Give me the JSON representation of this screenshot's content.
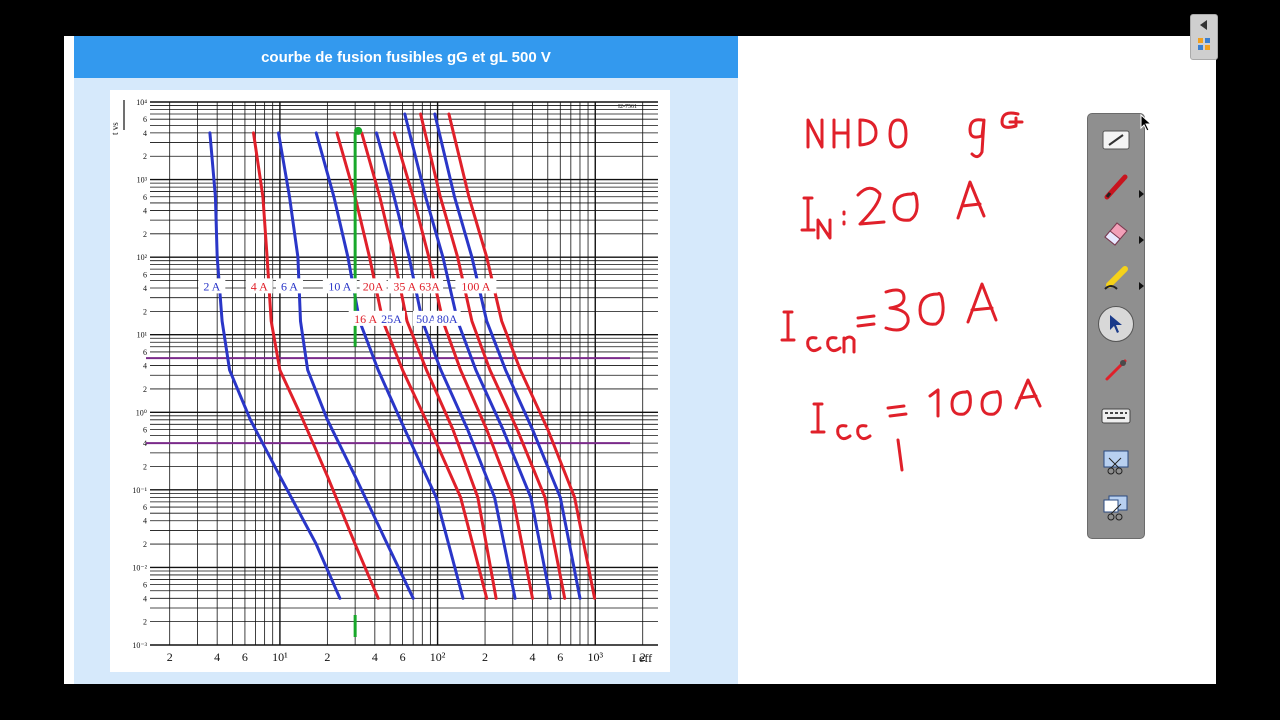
{
  "document": {
    "title": "courbe de fusion fusibles gG et gL 500 V",
    "chart_code": "I2-7561"
  },
  "chart_data": {
    "type": "line",
    "title": "courbe de fusion fusibles gG et gL 500 V",
    "xlabel": "I eff",
    "ylabel": "t vs",
    "x_scale": "log",
    "y_scale": "log",
    "xlim": [
      1.5,
      2500
    ],
    "ylim": [
      0.001,
      10000
    ],
    "x_tick_labels": [
      "2",
      "4",
      "6",
      "10¹",
      "2",
      "4",
      "6",
      "10²",
      "2",
      "4",
      "6",
      "10³",
      "2"
    ],
    "y_tick_labels": [
      "10⁴",
      "6",
      "4",
      "2",
      "10³",
      "6",
      "4",
      "2",
      "10²",
      "6",
      "4",
      "2",
      "10¹",
      "6",
      "4",
      "2",
      "10⁰",
      "6",
      "4",
      "2",
      "10⁻¹",
      "6",
      "4",
      "2",
      "10⁻²",
      "6",
      "4",
      "2",
      "10⁻³"
    ],
    "grid": true,
    "series": [
      {
        "name": "2 A",
        "color": "#2a36c8",
        "x": [
          3.6,
          3.9,
          4.0,
          4.3,
          4.8,
          6.5,
          10,
          17,
          24
        ],
        "y": [
          4000,
          600,
          100,
          15,
          3.5,
          0.8,
          0.15,
          0.02,
          0.004
        ]
      },
      {
        "name": "4 A",
        "color": "#e0202a",
        "x": [
          6.8,
          7.8,
          8.3,
          8.8,
          10,
          14,
          20,
          30,
          42
        ],
        "y": [
          4000,
          600,
          100,
          15,
          3.5,
          0.8,
          0.15,
          0.02,
          0.004
        ]
      },
      {
        "name": "6 A",
        "color": "#2a36c8",
        "x": [
          9.8,
          11.5,
          13,
          13.5,
          15,
          20,
          30,
          48,
          70
        ],
        "y": [
          4000,
          600,
          100,
          15,
          3.5,
          0.8,
          0.15,
          0.02,
          0.004
        ]
      },
      {
        "name": "10 A",
        "color": "#2a36c8",
        "x": [
          17,
          22,
          27,
          32,
          42,
          62,
          98,
          145
        ],
        "y": [
          4000,
          600,
          100,
          15,
          3.5,
          0.6,
          0.08,
          0.004
        ]
      },
      {
        "name": "16 A",
        "color": "#e0202a",
        "x": [
          23,
          30,
          37,
          45,
          60,
          90,
          140,
          205
        ],
        "y": [
          4000,
          600,
          100,
          15,
          3.5,
          0.6,
          0.08,
          0.004
        ]
      },
      {
        "name": "20A",
        "color": "#e0202a",
        "x": [
          33,
          43,
          53,
          64,
          85,
          125,
          180,
          235
        ],
        "y": [
          4000,
          600,
          100,
          15,
          3.5,
          0.6,
          0.08,
          0.004
        ]
      },
      {
        "name": "25A",
        "color": "#2a36c8",
        "x": [
          41,
          53,
          66,
          80,
          105,
          155,
          230,
          310
        ],
        "y": [
          4000,
          600,
          100,
          15,
          3.5,
          0.6,
          0.08,
          0.004
        ]
      },
      {
        "name": "35 A",
        "color": "#e0202a",
        "x": [
          53,
          70,
          88,
          108,
          140,
          205,
          300,
          400
        ],
        "y": [
          4000,
          600,
          100,
          15,
          3.5,
          0.6,
          0.08,
          0.004
        ]
      },
      {
        "name": "50A",
        "color": "#2a36c8",
        "x": [
          62,
          84,
          108,
          134,
          175,
          260,
          390,
          520
        ],
        "y": [
          7000,
          600,
          100,
          15,
          3.5,
          0.6,
          0.08,
          0.004
        ]
      },
      {
        "name": "63A",
        "color": "#e0202a",
        "x": [
          78,
          104,
          134,
          165,
          215,
          320,
          480,
          640
        ],
        "y": [
          7000,
          600,
          100,
          15,
          3.5,
          0.6,
          0.08,
          0.004
        ]
      },
      {
        "name": "80A",
        "color": "#2a36c8",
        "x": [
          96,
          128,
          165,
          205,
          270,
          400,
          600,
          800
        ],
        "y": [
          7000,
          600,
          100,
          15,
          3.5,
          0.6,
          0.08,
          0.004
        ]
      },
      {
        "name": "100 A",
        "color": "#e0202a",
        "x": [
          118,
          158,
          205,
          255,
          335,
          500,
          740,
          990
        ],
        "y": [
          7000,
          600,
          100,
          15,
          3.5,
          0.6,
          0.08,
          0.004
        ]
      }
    ],
    "series_labels": [
      {
        "name": "2 A",
        "x": 3.7,
        "y": 42
      },
      {
        "name": "4 A",
        "x": 7.4,
        "y": 42
      },
      {
        "name": "6 A",
        "x": 11.5,
        "y": 42
      },
      {
        "name": "10 A",
        "x": 24,
        "y": 42
      },
      {
        "name": "20A",
        "x": 39,
        "y": 42
      },
      {
        "name": "35 A",
        "x": 62,
        "y": 42
      },
      {
        "name": "63A",
        "x": 89,
        "y": 42
      },
      {
        "name": "100 A",
        "x": 175,
        "y": 42
      },
      {
        "name": "16 A",
        "x": 35,
        "y": 16
      },
      {
        "name": "25A",
        "x": 51,
        "y": 16
      },
      {
        "name": "50A",
        "x": 85,
        "y": 16
      },
      {
        "name": "80A",
        "x": 115,
        "y": 16
      }
    ],
    "annotations": {
      "green_marker": {
        "color": "#18a82a",
        "x": 30,
        "y_from": 7,
        "y_to": 4000
      },
      "horizontal_lines": [
        {
          "color": "#7a2a8a",
          "y": 5
        },
        {
          "color": "#7a2a8a",
          "y": 0.4
        }
      ]
    }
  },
  "handwriting": {
    "line1": "NH00 gG",
    "line2": "IN = 20 A",
    "line3": "Icc = 30 A",
    "line4": "Icc1 = 100 A"
  },
  "toolbar": {
    "tools": [
      "pen-tray-icon",
      "pen-icon",
      "eraser-icon",
      "highlighter-icon",
      "select-arrow-icon",
      "magic-pen-icon",
      "keyboard-icon",
      "screen-capture-icon",
      "area-capture-icon"
    ]
  }
}
